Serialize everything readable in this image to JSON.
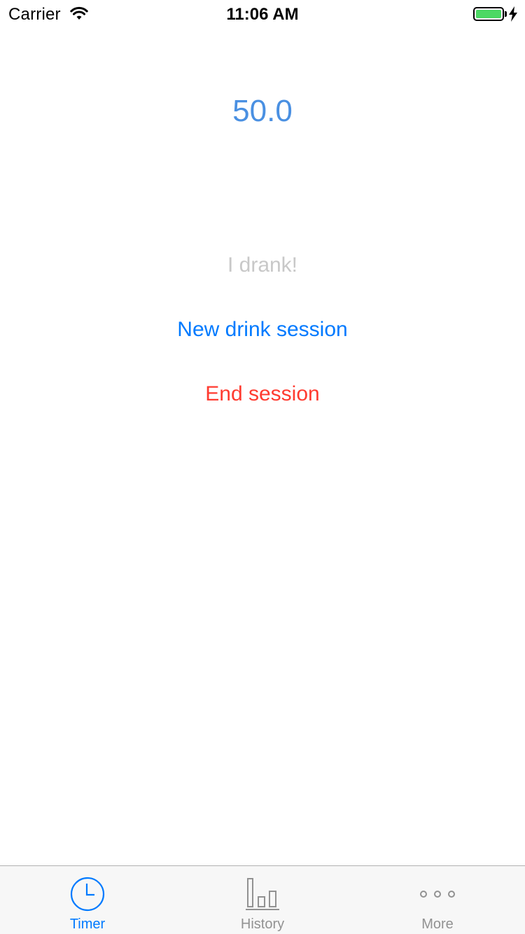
{
  "status_bar": {
    "carrier": "Carrier",
    "time": "11:06 AM",
    "battery_color": "#4cd964"
  },
  "main": {
    "timer_value": "50.0",
    "timer_color": "#4a90e2",
    "drank_label": "I drank!",
    "new_session_label": "New drink session",
    "end_session_label": "End session"
  },
  "tab_bar": {
    "active_color": "#007aff",
    "tabs": [
      {
        "label": "Timer",
        "icon": "clock-icon",
        "active": true
      },
      {
        "label": "History",
        "icon": "bar-chart-icon",
        "active": false
      },
      {
        "label": "More",
        "icon": "more-dots-icon",
        "active": false
      }
    ]
  }
}
